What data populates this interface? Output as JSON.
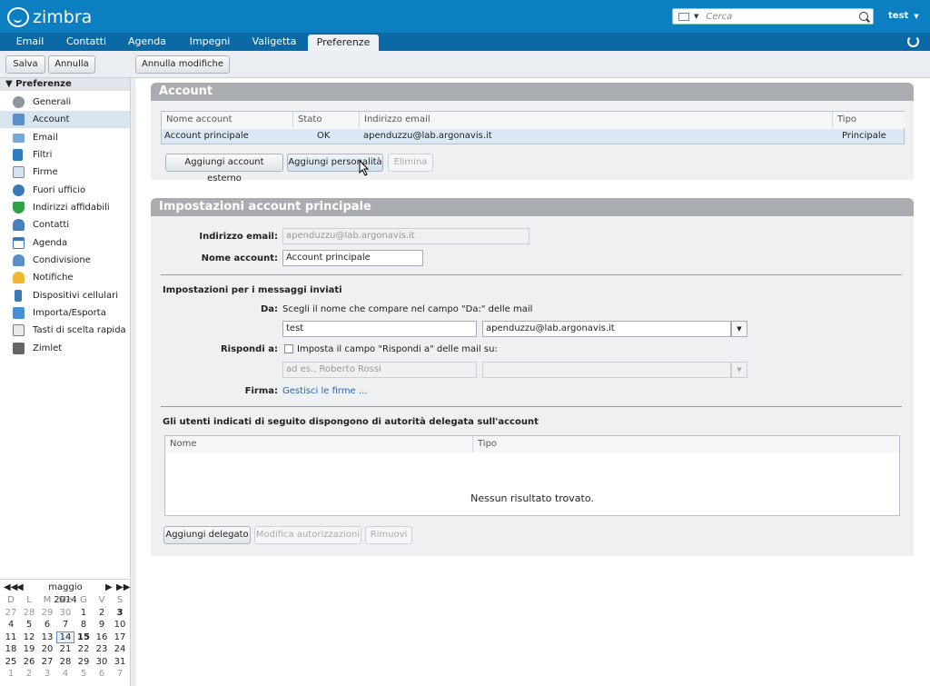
{
  "app": {
    "logo": "zimbra",
    "user": "test"
  },
  "search": {
    "placeholder": "Cerca"
  },
  "nav": {
    "tabs": [
      "Email",
      "Contatti",
      "Agenda",
      "Impegni",
      "Valigetta",
      "Preferenze"
    ],
    "active": "Preferenze"
  },
  "toolbar": {
    "save": "Salva",
    "cancel": "Annulla",
    "undo_changes": "Annulla modifiche"
  },
  "sidebar": {
    "header": "Preferenze",
    "items": [
      {
        "label": "Generali",
        "icon": "gear-icon"
      },
      {
        "label": "Account",
        "icon": "account-icon"
      },
      {
        "label": "Email",
        "icon": "envelope-icon"
      },
      {
        "label": "Filtri",
        "icon": "filter-icon"
      },
      {
        "label": "Firme",
        "icon": "signature-icon"
      },
      {
        "label": "Fuori ufficio",
        "icon": "out-of-office-icon"
      },
      {
        "label": "Indirizzi affidabili",
        "icon": "shield-check-icon"
      },
      {
        "label": "Contatti",
        "icon": "contact-icon"
      },
      {
        "label": "Agenda",
        "icon": "calendar-icon"
      },
      {
        "label": "Condivisione",
        "icon": "share-icon"
      },
      {
        "label": "Notifiche",
        "icon": "bell-icon"
      },
      {
        "label": "Dispositivi cellulari",
        "icon": "mobile-icon"
      },
      {
        "label": "Importa/Esporta",
        "icon": "import-export-icon"
      },
      {
        "label": "Tasti di scelta rapida",
        "icon": "keyboard-icon"
      },
      {
        "label": "Zimlet",
        "icon": "zimlet-icon"
      }
    ],
    "active_index": 1
  },
  "calendar": {
    "month_label": "maggio 2014",
    "dow": [
      "D",
      "L",
      "M",
      "Me",
      "G",
      "V",
      "S"
    ],
    "weeks": [
      [
        "27",
        "28",
        "29",
        "30",
        "1",
        "2",
        "3"
      ],
      [
        "4",
        "5",
        "6",
        "7",
        "8",
        "9",
        "10"
      ],
      [
        "11",
        "12",
        "13",
        "14",
        "15",
        "16",
        "17"
      ],
      [
        "18",
        "19",
        "20",
        "21",
        "22",
        "23",
        "24"
      ],
      [
        "25",
        "26",
        "27",
        "28",
        "29",
        "30",
        "31"
      ],
      [
        "1",
        "2",
        "3",
        "4",
        "5",
        "6",
        "7"
      ]
    ],
    "today": "14",
    "bold_dates": [
      "3",
      "15"
    ]
  },
  "account_panel": {
    "title": "Account",
    "columns": [
      "Nome account",
      "Stato",
      "Indirizzo email",
      "Tipo"
    ],
    "rows": [
      [
        "Account principale",
        "OK",
        "apenduzzu@lab.argonavis.it",
        "Principale"
      ]
    ],
    "buttons": {
      "add_external": "Aggiungi account esterno",
      "add_persona": "Aggiungi personalità",
      "delete": "Elimina"
    }
  },
  "settings_panel": {
    "title": "Impostazioni account principale",
    "email_label": "Indirizzo email:",
    "email_value": "apenduzzu@lab.argonavis.it",
    "name_label": "Nome account:",
    "name_value": "Account principale",
    "sent_section": "Impostazioni per i messaggi inviati",
    "from_label": "Da:",
    "from_hint": "Scegli il nome che compare nel campo \"Da:\" delle mail",
    "from_name": "test",
    "from_address": "apenduzzu@lab.argonavis.it",
    "reply_label": "Rispondi a:",
    "reply_checkbox": "Imposta il campo \"Rispondi a\" delle mail su:",
    "reply_placeholder": "ad es., Roberto Rossi",
    "signature_label": "Firma:",
    "signature_link": "Gestisci le firme ...",
    "delegate_section": "Gli utenti indicati di seguito dispongono di autorità delegata sull'account",
    "delegate_columns": [
      "Nome",
      "Tipo"
    ],
    "delegate_empty": "Nessun risultato trovato.",
    "buttons": {
      "add_delegate": "Aggiungi delegato",
      "edit_permissions": "Modifica autorizzazioni",
      "remove": "Rimuovi"
    }
  }
}
